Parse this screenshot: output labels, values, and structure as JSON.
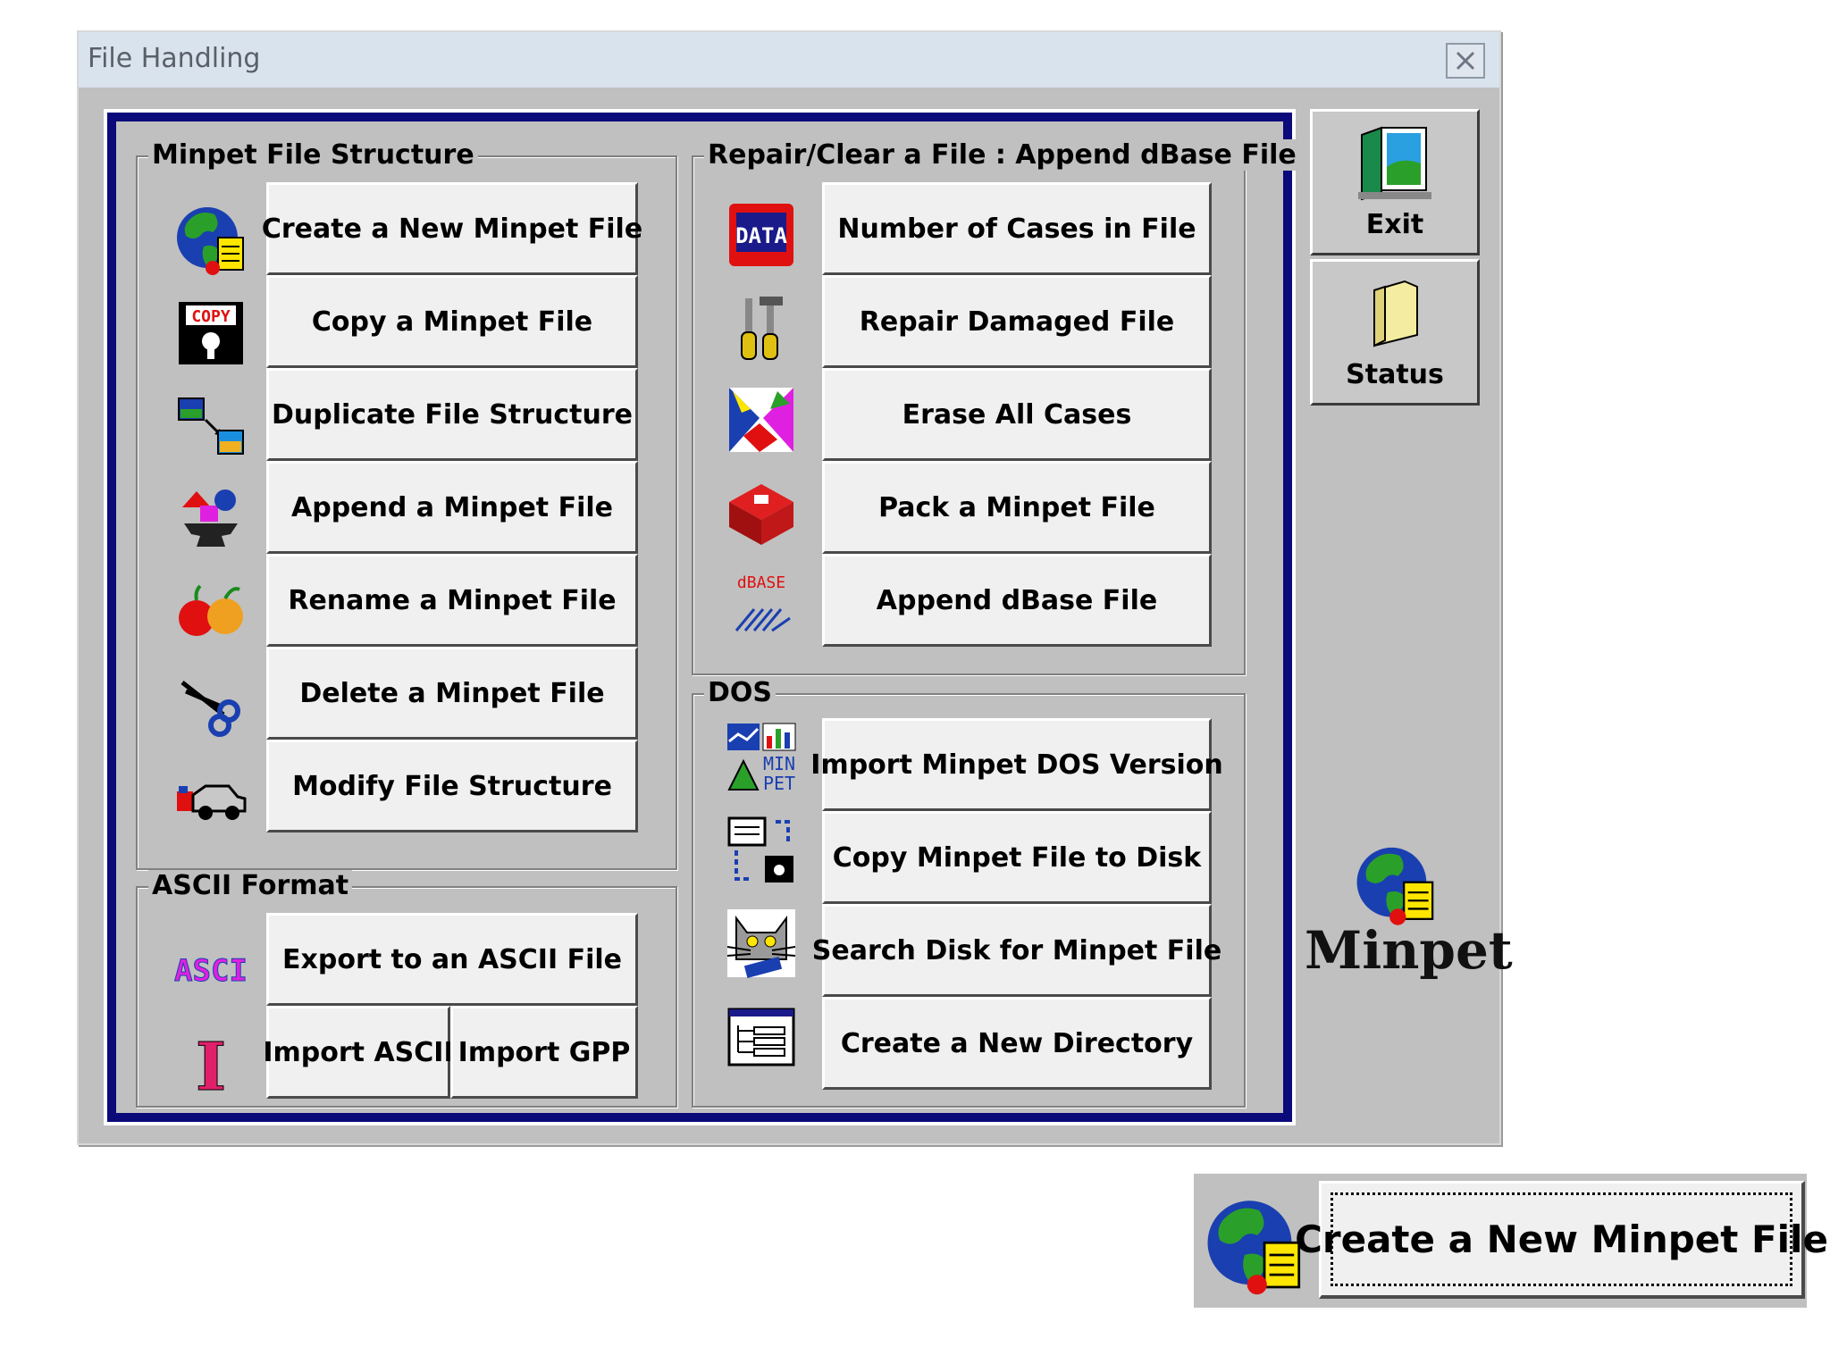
{
  "window": {
    "title": "File Handling"
  },
  "groups": {
    "structure": {
      "label": "Minpet File Structure",
      "buttons": [
        {
          "label": "Create a New Minpet File",
          "icon": "globe-database-icon"
        },
        {
          "label": "Copy a Minpet File",
          "icon": "floppy-copy-icon"
        },
        {
          "label": "Duplicate File Structure",
          "icon": "duplicate-pictures-icon"
        },
        {
          "label": "Append a Minpet File",
          "icon": "anvil-shapes-icon"
        },
        {
          "label": "Rename a Minpet File",
          "icon": "apple-orange-icon"
        },
        {
          "label": "Delete a Minpet File",
          "icon": "scissors-icon"
        },
        {
          "label": "Modify File Structure",
          "icon": "tow-truck-icon"
        }
      ]
    },
    "ascii": {
      "label": "ASCII Format",
      "export_label": "Export to an ASCII File",
      "import_ascii_label": "Import ASCII",
      "import_gpp_label": "Import GPP",
      "export_icon_text": "ASCI",
      "import_icon_text": "I"
    },
    "repair": {
      "label": "Repair/Clear a File : Append dBase File",
      "buttons": [
        {
          "label": "Number of Cases in File",
          "icon": "data-icon"
        },
        {
          "label": "Repair Damaged File",
          "icon": "tools-icon"
        },
        {
          "label": "Erase All Cases",
          "icon": "erase-paint-icon"
        },
        {
          "label": "Pack a Minpet File",
          "icon": "pack-box-icon"
        },
        {
          "label": "Append dBase File",
          "icon": "dbase-icon"
        }
      ],
      "data_icon_text": "DATA",
      "dbase_icon_text": "dBASE"
    },
    "dos": {
      "label": "DOS",
      "buttons": [
        {
          "label": "Import Minpet DOS Version",
          "icon": "minpet-dos-icon"
        },
        {
          "label": "Copy Minpet File to Disk",
          "icon": "copy-to-disk-icon"
        },
        {
          "label": "Search Disk for Minpet File",
          "icon": "search-cat-icon"
        },
        {
          "label": "Create a New Directory",
          "icon": "directory-icon"
        }
      ],
      "minpet_icon_text_1": "MIN",
      "minpet_icon_text_2": "PET"
    }
  },
  "side": {
    "exit_label": "Exit",
    "status_label": "Status",
    "brand": "Minpet"
  },
  "icon_texts": {
    "copy": "COPY"
  },
  "zoom": {
    "label": "Create a New Minpet File"
  },
  "colors": {
    "frame_border": "#0a0a7a",
    "face": "#c0c0c0",
    "button_face": "#f0f0f0"
  }
}
